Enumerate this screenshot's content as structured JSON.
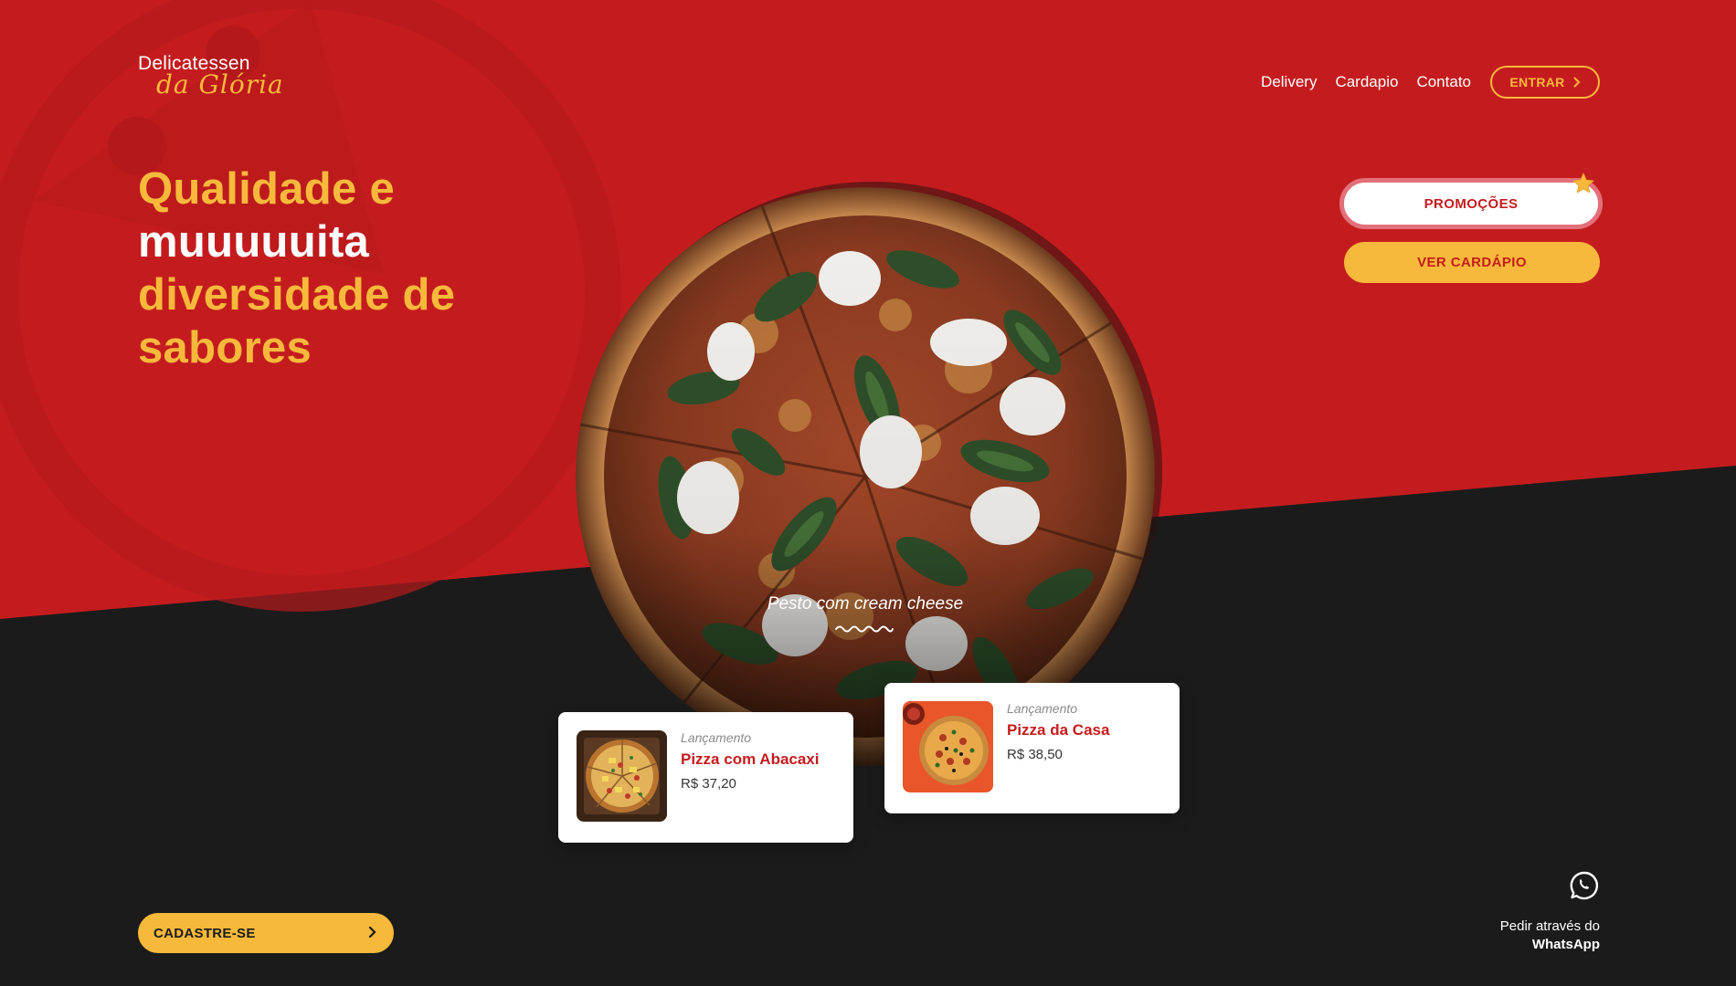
{
  "brand": {
    "line1": "Delicatessen",
    "line2": "da Glória"
  },
  "nav": {
    "items": [
      "Delivery",
      "Cardapio",
      "Contato"
    ],
    "login_label": "ENTRAR"
  },
  "hero": {
    "headline_part1": "Qualidade e",
    "headline_part2": "muuuuuita",
    "headline_part3": "diversidade de",
    "headline_part4": "sabores"
  },
  "actions": {
    "promo_label": "PROMOÇÕES",
    "menu_label": "VER CARDÁPIO"
  },
  "featured": {
    "caption": "Pesto com cream cheese"
  },
  "products": [
    {
      "tag": "Lançamento",
      "name": "Pizza com Abacaxi",
      "price": "R$ 37,20"
    },
    {
      "tag": "Lançamento",
      "name": "Pizza da Casa",
      "price": "R$ 38,50"
    }
  ],
  "footer": {
    "signup_label": "CADASTRE-SE",
    "whatsapp_line1": "Pedir através do",
    "whatsapp_line2": "WhatsApp"
  },
  "colors": {
    "red": "#c41c1e",
    "yellow": "#f7b93b",
    "dark": "#1b1b1b",
    "white": "#ffffff"
  },
  "icons": [
    "chevron-right-icon",
    "star-icon",
    "whatsapp-icon",
    "wave-divider-icon"
  ]
}
